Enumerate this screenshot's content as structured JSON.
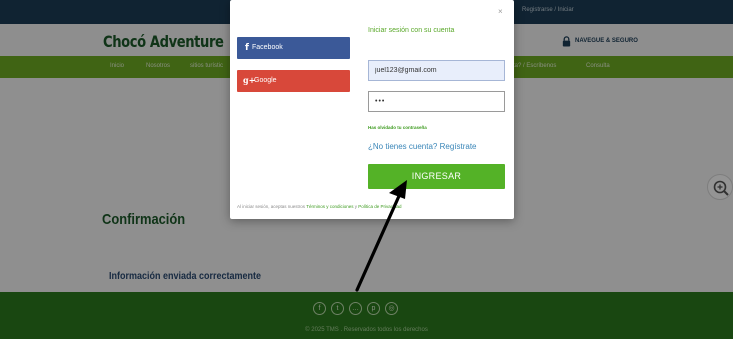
{
  "topbar": {
    "link_label": "Registrarse / Iniciar"
  },
  "header": {
    "site_title": "Chocó Adventure",
    "secure_label": "NAVEGUE & SEGURO"
  },
  "nav": {
    "items": [
      {
        "label": "Inicio"
      },
      {
        "label": "Nosotros"
      },
      {
        "label": "sitios turístic"
      },
      {
        "label": "ta? / Escríbenos"
      },
      {
        "label": "Consulta"
      }
    ]
  },
  "content": {
    "confirm_title": "Confirmación",
    "confirm_message": "Información enviada correctamente"
  },
  "footer": {
    "social_icons": [
      "facebook-icon",
      "twitter-icon",
      "chat-icon",
      "pinterest-icon",
      "instagram-icon"
    ],
    "copyright": "© 2025 TMS . Reservados todos los derechos"
  },
  "modal": {
    "close_label": "×",
    "facebook_label": "Facebook",
    "facebook_glyph": "f",
    "google_label": "Google",
    "google_glyph": "g+",
    "login_title": "Iniciar sesión con su cuenta",
    "email_value": "juel123@gmail.com",
    "password_value": "•••",
    "forgot_label": "Has olvidado tu contraseña",
    "register_label": "¿No tienes cuenta? Regístrate",
    "submit_label": "INGRESAR",
    "terms_prefix": "Al iniciar sesión, aceptas nuestros ",
    "terms_link": "Términos y condiciones",
    "terms_middle": " y ",
    "privacy_link": "Política de Privacidad"
  },
  "colors": {
    "topbar": "#1c3d57",
    "nav_green": "#6fac24",
    "footer_green": "#2c7a1e",
    "facebook_blue": "#3b5998",
    "google_red": "#d8483a",
    "submit_green": "#54b227",
    "overlay": "rgba(0,0,0,0.42)"
  }
}
